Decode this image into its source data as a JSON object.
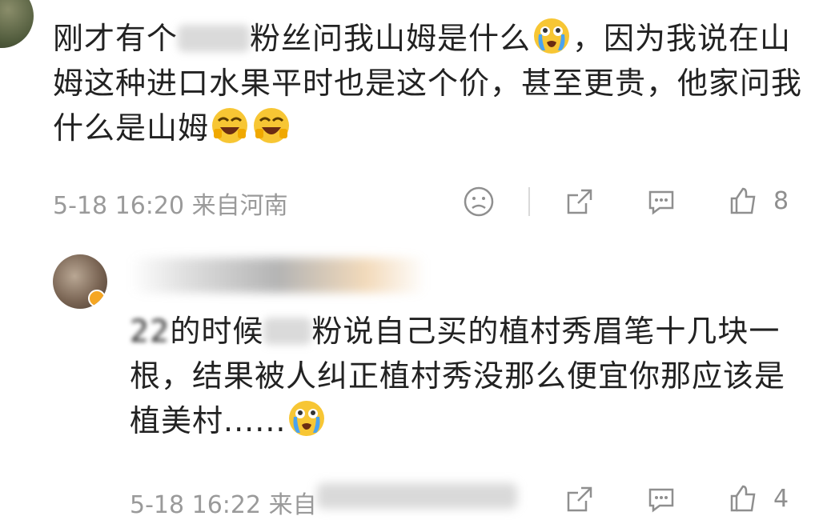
{
  "comment1": {
    "text_a": "刚才有个",
    "text_b": "粉丝问我山姆是什么",
    "text_c": "，因为我说在山姆这种进口水果平时也是这个价，甚至更贵，他家问我什么是山姆",
    "time": "5-18 16:20",
    "location": "来自河南",
    "likes": "8"
  },
  "comment2": {
    "text_a": "22",
    "text_b": "的时候",
    "text_c": "粉说自己买的植村秀眉笔十几块一根，结果被人纠正植村秀没那么便宜你那应该是植美村......",
    "time": "5-18 16:22",
    "location": "来自",
    "likes": "4"
  },
  "icons": {
    "dislike": "frown-icon",
    "share": "share-icon",
    "reply": "comment-icon",
    "like": "thumb-up-icon",
    "emoji_cry": "crying-emoji-icon",
    "emoji_laugh": "laugh-cry-emoji-icon"
  },
  "colors": {
    "text": "#222222",
    "meta": "#9a9a9a",
    "icon": "#8f8f8f",
    "emoji": "#f7c634"
  }
}
